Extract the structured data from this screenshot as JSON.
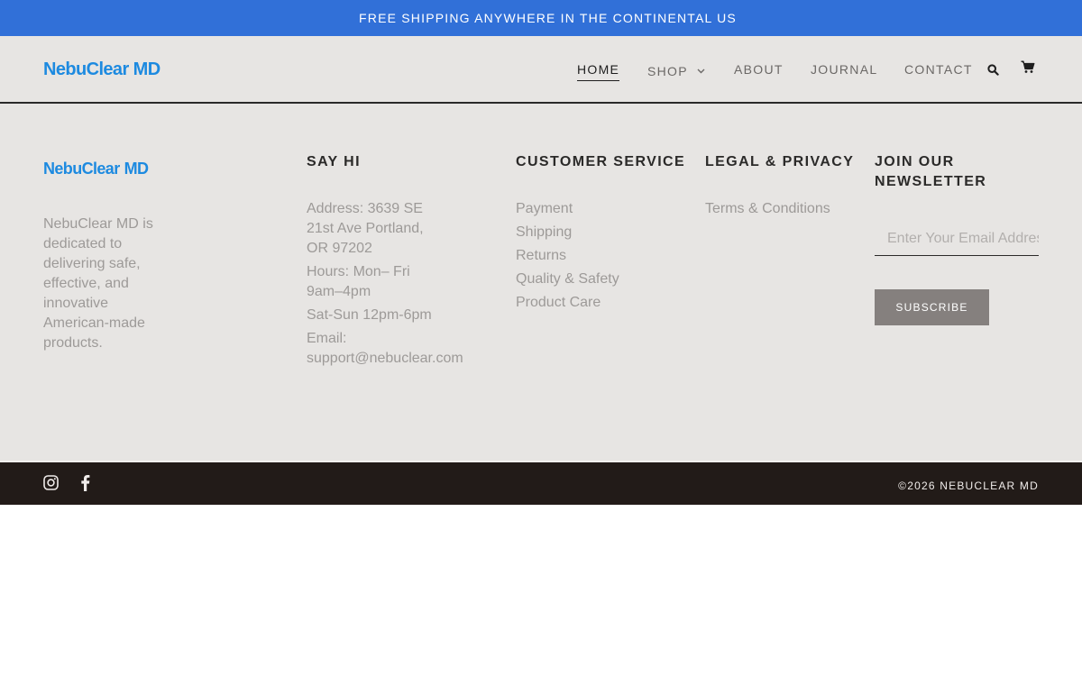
{
  "announcement": "FREE SHIPPING ANYWHERE IN THE CONTINENTAL US",
  "brand": {
    "name": "NebuClear",
    "suffix": "MD"
  },
  "nav": {
    "home": "HOME",
    "shop": "SHOP",
    "about": "ABOUT",
    "journal": "JOURNAL",
    "contact": "CONTACT"
  },
  "icons": {
    "search": "search-icon",
    "cart": "cart-icon",
    "instagram": "instagram-icon",
    "facebook": "facebook-icon"
  },
  "footer": {
    "about": "NebuClear MD is dedicated to delivering safe, effective, and innovative American-made products.",
    "say_hi": {
      "heading": "SAY HI",
      "address": "Address: 3639 SE 21st Ave Portland, OR 97202",
      "hours": "Hours: Mon– Fri 9am–4pm",
      "weekend": "Sat-Sun 12pm-6pm",
      "email": "Email: support@nebuclear.com"
    },
    "customer_service": {
      "heading": "CUSTOMER SERVICE",
      "links": [
        "Payment",
        "Shipping",
        "Returns",
        "Quality & Safety",
        "Product Care"
      ]
    },
    "legal": {
      "heading": "LEGAL & PRIVACY",
      "links": [
        "Terms & Conditions"
      ]
    },
    "newsletter": {
      "heading": "JOIN OUR NEWSLETTER",
      "placeholder": "Enter Your Email Address",
      "button": "SUBSCRIBE"
    }
  },
  "copyright": "©2026 NEBUCLEAR MD",
  "colors": {
    "announcement_bg": "#3170d8",
    "brand": "#1d8ae0",
    "footer_bg": "#e7e5e3",
    "bottom_bar_bg": "#221b18",
    "button_bg": "#85807e"
  }
}
